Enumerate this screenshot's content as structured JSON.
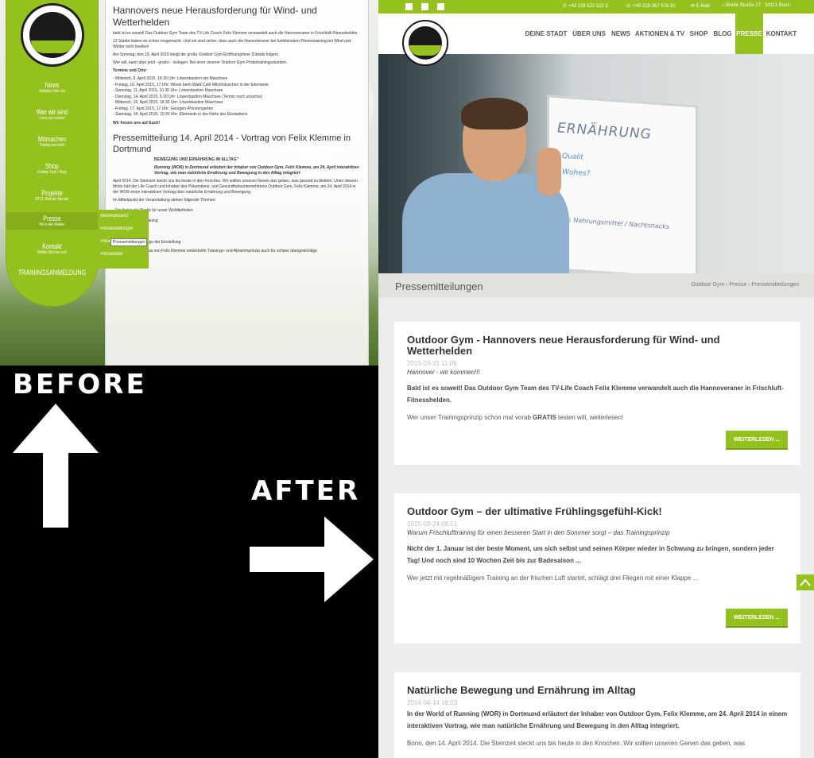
{
  "labels": {
    "before": "BEFORE",
    "after": "AFTER"
  },
  "before": {
    "nav": [
      {
        "title": "News",
        "sub": "Aktuelles über uns"
      },
      {
        "title": "Wer wir sind",
        "sub": "Lerne uns kennen"
      },
      {
        "title": "Mitmachen",
        "sub": "Training und mehr"
      },
      {
        "title": "Shop",
        "sub": "Outdoor Gym / Shop"
      },
      {
        "title": "Projekte",
        "sub": "RTL2, Welt der Wunder"
      },
      {
        "title": "Presse",
        "sub": "Wir in den Medien"
      },
      {
        "title": "Kontakt",
        "sub": "Meldet Dich bei uns!"
      },
      {
        "title": "TRAININGSANMELDUNG",
        "sub": ""
      }
    ],
    "flyout": [
      "Medienpräsenz",
      "Pressemeldungen",
      "Pressekontakt",
      "Pressebilder"
    ],
    "tooltip": "Pressemeldungen",
    "content": {
      "h1": "Hannovers neue Herausforderung für Wind- und Wetterhelden",
      "p1": "bald ist es soweit! Das Outdoor Gym Team des TV-Life Coach Felix Klemme verwandelt auch die Hannoveraner in Frischluft-Fitnesshelden.",
      "p2": "13 Städte haben es schon vorgemacht. Und wir sind sicher, dass auch die Hannoveraner bei funktionalem Fitnesstraining bei Wind und Wetter nicht kneifen!",
      "p3": "Am Sonntag, den 19. April 2015 steigt die große Outdoor Gym Eröffnungsfeier (Details folgen).",
      "p4": "Wer will, kann aber jetzt - gratis! - loslegen. Bei einer unserer Outdoor Gym Probetrainingsstunden.",
      "p5": "Termine und Orte:",
      "dates": [
        "- Mittwoch, 8. April 2015, 18.30 Uhr: Löwenbastion am Maschsee",
        "- Freitag, 10. April 2015, 17 Uhr: Wiese beim Wald-Café Milchhäuschen in der Eilenriede",
        "- Samstag, 11. April 2015, 10.30 Uhr: Löwenbastion Maschsee",
        "- Dienstag, 14. April 2015, 6.30 Uhr: Löwenbastion Maschsee (Termin noch unsicher)",
        "- Mittwoch, 15. April 2015, 18.30 Uhr: Löwenbastion Maschsee",
        "- Freitag, 17. April 2015, 17 Uhr: Georgen-/Prinzengarten",
        "- Samstag, 18. April 2015, 10.30 Uhr: Eilenriede in der Nähe des Eisstadions"
      ],
      "p6": "Wir freuen uns auf Euch!",
      "h2": "Pressemitteilung 14. April 2014 - Vortrag von Felix Klemme in Dortmund",
      "p7": "BEWEGUNG UND ERNÄHRUNG IM ALLTAG\"",
      "p8": "Running (WOR) in Dortmund erläutert der Inhaber von Outdoor Gym, Felix Klemme, am 24. April interaktiven Vortrag, wie man natürliche Ernährung und Bewegung in den Alltag integriert",
      "p9": "April 2014. Die Steinzeit steckt uns bis heute in den Knochen. Wir sollten unseren Genen das geben, was gesund zu bleiben. Unter diesem Motto hält der Life Coach und Inhaber des Präventions- und Gesundheitsunternehmens Outdoor Gym, Felix Klemme, am 24. April 2014 in der WOR einen interaktiven Vortrag über natürliche Ernährung und Bewegung.",
      "p10": "Im Mittelpunkt der Veranstaltung stehen folgende Themen:",
      "topics": [
        "- Die Natur als Quelle für unser Wohlbefinden",
        "- Bewegung statt Training",
        "- Nie mehr Diät",
        "- Gesundheit als Frage der Einstellung"
      ],
      "p11": "Wie herausragend das von Felix Klemme entwickelte Trainings- und Abnehmprinzip auch für schwer übergewichtige"
    }
  },
  "after": {
    "topbar": {
      "phone1": "+49 228 522 522 5",
      "phone2": "+49 228 367 676 50",
      "email": "E-Mail",
      "address": "Breite Straße 27 · 53111 Bonn"
    },
    "nav": [
      "DEINE STADT",
      "ÜBER UNS",
      "NEWS",
      "AKTIONEN & TV",
      "SHOP",
      "BLOG",
      "PRESSE",
      "KONTAKT"
    ],
    "hero": {
      "word": "ERNÄHRUNG",
      "line1": "- Qualit",
      "line2": "- Wohes?",
      "line3": "50% Nahrungsmittel / Nachtsnacks"
    },
    "page_title": "Pressemitteilungen",
    "breadcrumb": [
      "Outdoor Gym",
      "Presse",
      "Pressemitteilungen"
    ],
    "posts": [
      {
        "title": "Outdoor Gym - Hannovers neue Herausforderung für Wind- und Wetterhelden",
        "date": "2015-03-31 11:09",
        "lead": "Hannover - wir kommen!!!",
        "bold": "Bald ist es soweit! Das Outdoor Gym Team des TV-Life Coach Felix Klemme verwandelt auch die Hannoveraner in Frischluft-Fitnesshelden.",
        "text_a": "Wer unser Trainingsprinzip schon mal vorab ",
        "text_b": "GRATIS",
        "text_c": " testen will, weiterlesen!",
        "button": "WEITERLESEN ..."
      },
      {
        "title": "Outdoor Gym – der ultimative Frühlingsgefühl-Kick!",
        "date": "2015-03-24 08:51",
        "lead": "Warum Frischlufttraining für einen besseren Start in den Sommer sorgt – das Trainingsprinzip",
        "bold": "Nicht der 1. Januar ist der beste Moment, um sich selbst und seinen Körper wieder in Schwung zu bringen, sondern jeder Tag! Und noch sind 10 Wochen Zeit bis zur Badesaison ...",
        "text": "Wer jetzt mit regelmäßigem Training an der frischen Luft startet, schlägt drei Fliegen mit einer Klappe ...",
        "button": "WEITERLESEN ..."
      },
      {
        "title": "Natürliche Bewegung und Ernährung im Alltag",
        "date": "2014-04-14 16:03",
        "bold": "In der World of Running (WOR) in Dortmund erläutert der Inhaber von Outdoor Gym, Felix Klemme, am 24. April 2014 in einem interaktiven Vortrag, wie man natürliche Ernährung und Bewegung in den Alltag integriert.",
        "text": "Bonn, den 14. April 2014. Die Steinzeit steckt uns bis heute in den Knochen. Wir sollten unseren Genen das geben, was"
      }
    ]
  },
  "icons": {
    "social": [
      "facebook-icon",
      "instagram-icon",
      "google-plus-icon"
    ],
    "to_top": "chevron-up-icon"
  },
  "colors": {
    "brand_green": "#95c11f",
    "dark": "#1a1a1a",
    "background": "#000000"
  }
}
